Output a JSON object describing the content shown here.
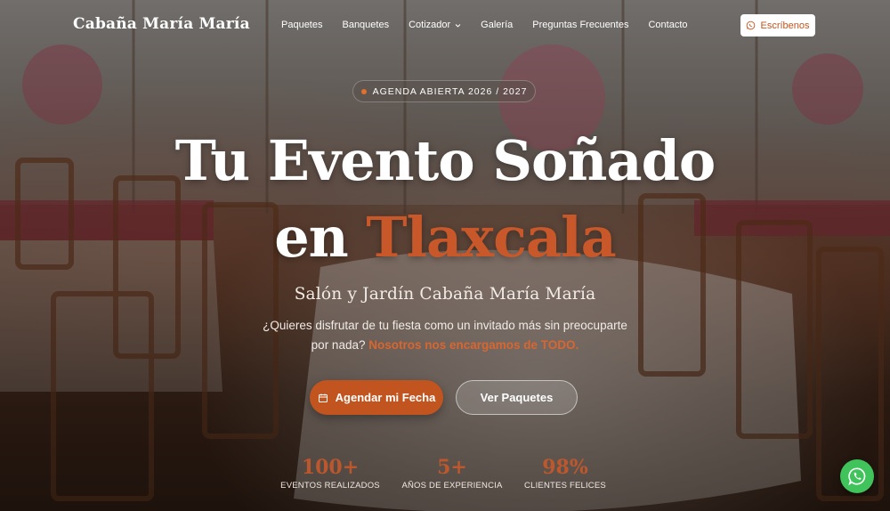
{
  "nav": {
    "brand": "Cabaña María María",
    "items": [
      {
        "label": "Paquetes"
      },
      {
        "label": "Banquetes"
      },
      {
        "label": "Cotizador",
        "icon": "chevron-down-icon"
      },
      {
        "label": "Galería"
      },
      {
        "label": "Preguntas Frecuentes"
      },
      {
        "label": "Contacto"
      }
    ],
    "cta_label": "Escríbenos",
    "cta_icon": "whatsapp-icon"
  },
  "hero": {
    "badge": "AGENDA ABIERTA 2026 / 2027",
    "title_line1": "Tu Evento Soñado",
    "title_line2_prefix": "en",
    "title_line2_accent": "Tlaxcala",
    "subtitle": "Salón y Jardín Cabaña María María",
    "description_line1": "¿Quieres disfrutar de tu fiesta como un invitado más sin preocuparte",
    "description_line2": "por nada?",
    "description_highlight": "Nosotros nos encargamos de TODO.",
    "primary_button": "Agendar mi Fecha",
    "primary_button_icon": "calendar-icon",
    "secondary_button": "Ver Paquetes"
  },
  "stats": [
    {
      "value": "100+",
      "label": "EVENTOS REALIZADOS"
    },
    {
      "value": "5+",
      "label": "AÑOS DE EXPERIENCIA"
    },
    {
      "value": "98%",
      "label": "CLIENTES FELICES"
    }
  ],
  "floating": {
    "icon": "whatsapp-icon"
  },
  "colors": {
    "accent": "#c2541f",
    "whatsapp": "#3fc35a"
  }
}
